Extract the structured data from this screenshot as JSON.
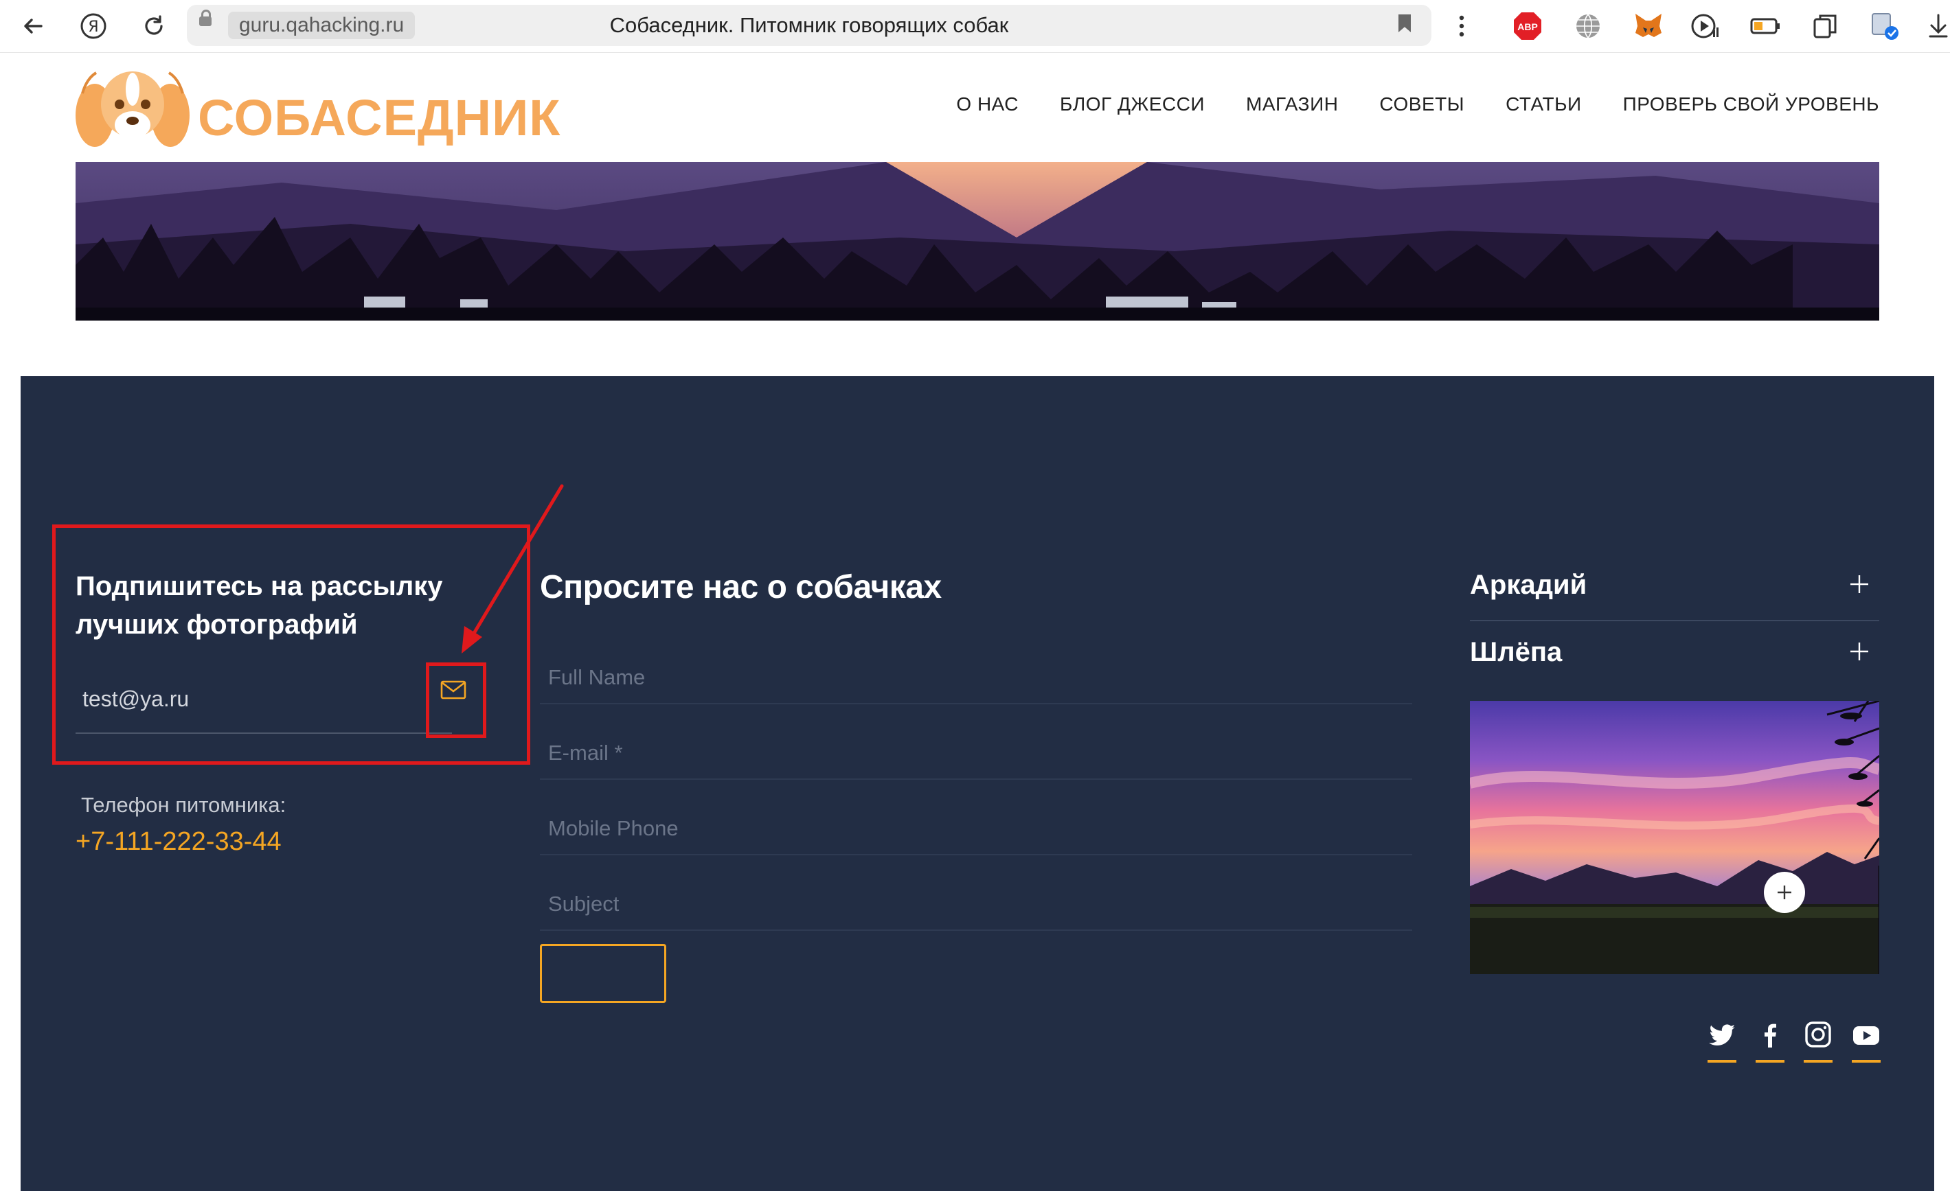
{
  "browser": {
    "domain": "guru.qahacking.ru",
    "page_title": "Собаседник. Питомник говорящих собак",
    "extensions": [
      "abp-icon",
      "globe-icon",
      "metamask-icon",
      "media-icon",
      "battery-icon",
      "collections-icon",
      "translate-icon",
      "download-icon"
    ],
    "abp_label": "ABP"
  },
  "site": {
    "logo_text": "СОБАСЕДНИК",
    "nav": [
      "О НАС",
      "БЛОГ ДЖЕССИ",
      "МАГАЗИН",
      "СОВЕТЫ",
      "СТАТЬИ",
      "ПРОВЕРЬ СВОЙ УРОВЕНЬ"
    ]
  },
  "subscribe": {
    "title": "Подпишитесь на рассылку лучших фотографий",
    "email_value": "test@ya.ru"
  },
  "contact": {
    "phone_label": "Телефон питомника:",
    "phone": "+7-111-222-33-44"
  },
  "form": {
    "title": "Спросите нас о собачках",
    "fields": [
      {
        "placeholder": "Full Name"
      },
      {
        "placeholder": "E-mail *"
      },
      {
        "placeholder": "Mobile Phone"
      },
      {
        "placeholder": "Subject"
      }
    ],
    "submit_label": ""
  },
  "accordion": [
    {
      "title": "Аркадий"
    },
    {
      "title": "Шлёпа"
    }
  ],
  "social": [
    "twitter-icon",
    "facebook-icon",
    "instagram-icon",
    "youtube-icon"
  ],
  "colors": {
    "footer_bg": "#222d44",
    "accent": "#f5a623",
    "logo": "#f5a85a",
    "annotation": "#e0191c"
  }
}
